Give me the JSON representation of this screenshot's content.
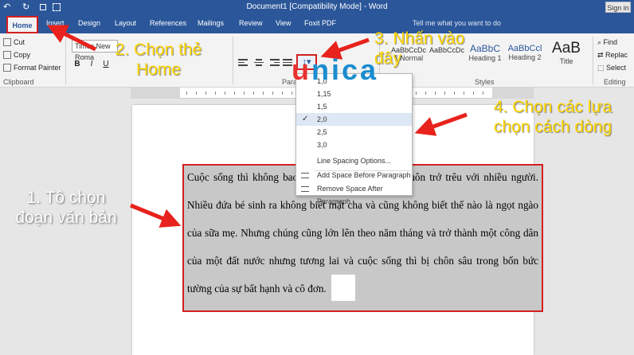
{
  "titlebar": {
    "title": "Document1 [Compatibility Mode] - Word",
    "signin": "Sign in",
    "qa_undo": "↶",
    "qa_redo": "↻"
  },
  "tabs": {
    "home": "Home",
    "insert": "Insert",
    "design": "Design",
    "layout": "Layout",
    "references": "References",
    "mailings": "Mailings",
    "review": "Review",
    "view": "View",
    "foxit": "Foxit PDF",
    "tell": "Tell me what you want to do"
  },
  "ribbon": {
    "cut": "Cut",
    "copy": "Copy",
    "format_painter": "Format Painter",
    "clipboard": "Clipboard",
    "font_value": "Times New Roma",
    "bold": "B",
    "italic": "I",
    "paragraph": "Para",
    "styles": "Styles",
    "editing": "Editing",
    "find": "Find",
    "replace": "Replac",
    "select": "Select",
    "style_normal_prev": "AaBbCcDc",
    "style_normal": "¶ Normal",
    "style_nospace_prev": "AaBbCcDc",
    "style_h1_prev": "AaBbC",
    "style_h1": "Heading 1",
    "style_h2_prev": "AaBbCcl",
    "style_h2": "Heading 2",
    "style_title_prev": "AaB",
    "style_title": "Title"
  },
  "dropdown": {
    "options": [
      "1,0",
      "1,15",
      "1,5",
      "2,0",
      "2,5",
      "3,0"
    ],
    "selected": "2,0",
    "line_spacing_options": "Line Spacing Options...",
    "add_space_before": "Add Space Before Paragraph",
    "remove_space_after": "Remove Space After Paragraph"
  },
  "document": {
    "paragraph": "Cuộc sống thì không bao giờ là hoàn hảo mà nó luôn trớ trêu với nhiều người. Nhiều đứa bé sinh ra không biết mặt cha và cũng không biết thế nào là ngọt ngào của sữa mẹ. Nhưng chúng cũng lớn lên theo năm tháng và trở thành một công dân của một đất nước nhưng tương lai và cuộc sống thì bị chôn sâu trong bốn bức tường của sự bất hạnh và cô đơn."
  },
  "callouts": {
    "step1": "1. Tô chọn đoạn văn bản",
    "step2": "2. Chọn thẻ Home",
    "step3": "3. Nhấn vào đây",
    "step4": "4. Chọn các lựa chọn cách dòng"
  },
  "brand": {
    "u": "u",
    "rest": "nica"
  },
  "colors": {
    "ribbon_blue": "#2b579a",
    "highlight_red": "#d42020",
    "callout_yellow": "#ffd700",
    "brand_blue": "#1a8ccf"
  }
}
